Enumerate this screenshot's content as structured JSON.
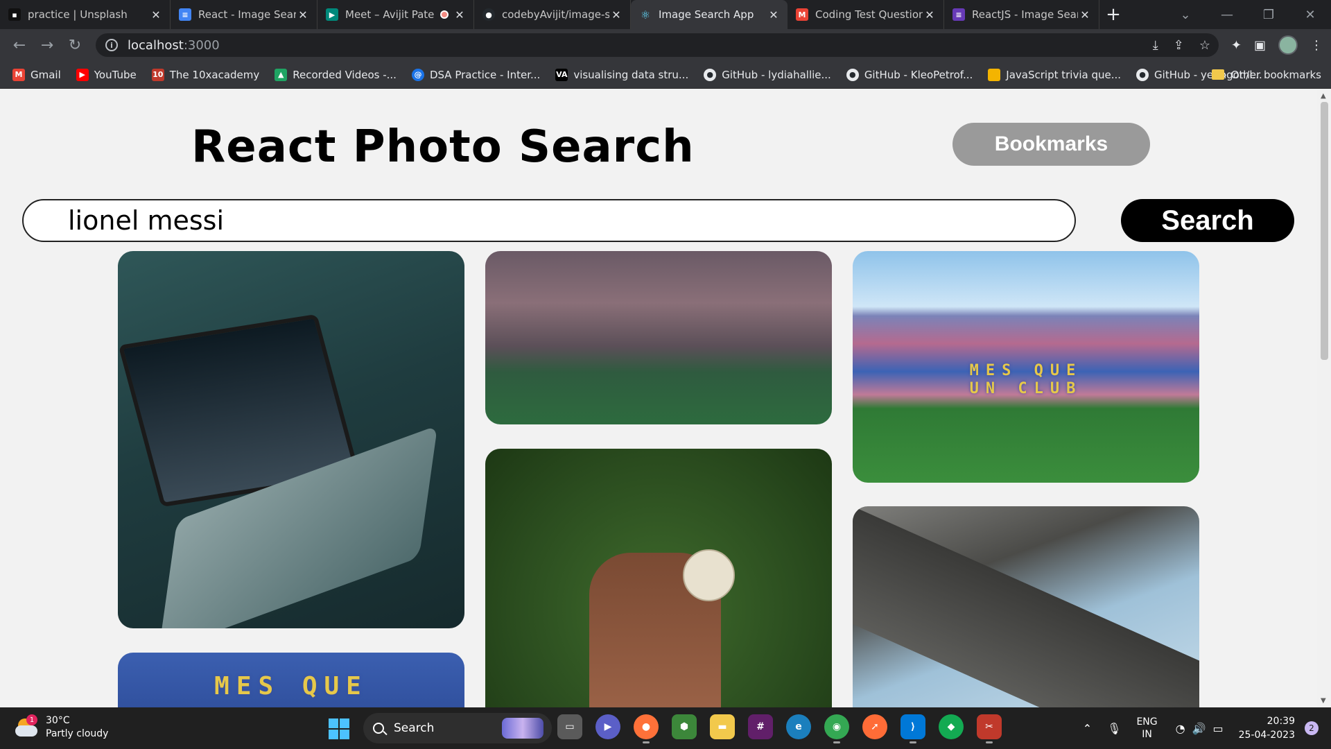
{
  "browser": {
    "tabs": [
      {
        "title": "practice | Unsplash",
        "icon": "unsplash-icon",
        "color": "#111111",
        "active": false
      },
      {
        "title": "React - Image Search",
        "icon": "docs-icon",
        "color": "#4285f4",
        "active": false
      },
      {
        "title": "Meet – Avijit Pate",
        "icon": "meet-icon",
        "color": "#00897b",
        "active": false,
        "recording": true
      },
      {
        "title": "codebyAvijit/image-se",
        "icon": "github-icon",
        "color": "#24292e",
        "active": false
      },
      {
        "title": "Image Search App",
        "icon": "react-icon",
        "color": "#35363a",
        "active": true
      },
      {
        "title": "Coding Test Question",
        "icon": "gmail-icon",
        "color": "#ea4335",
        "active": false
      },
      {
        "title": "ReactJS - Image Searc",
        "icon": "forms-icon",
        "color": "#673ab7",
        "active": false
      }
    ],
    "address": {
      "host": "localhost",
      "port": ":3000"
    },
    "bookmarks": [
      {
        "label": "Gmail",
        "icon": "gmail-icon",
        "color": "#ea4335"
      },
      {
        "label": "YouTube",
        "icon": "youtube-icon",
        "color": "#ff0000"
      },
      {
        "label": "The 10xacademy",
        "icon": "10x-icon",
        "color": "#c0392b"
      },
      {
        "label": "Recorded Videos -...",
        "icon": "drive-icon",
        "color": "#1fa463"
      },
      {
        "label": "DSA Practice - Inter...",
        "icon": "at-icon",
        "color": "#1a73e8"
      },
      {
        "label": "visualising data stru...",
        "icon": "visualgo-icon",
        "color": "#000000"
      },
      {
        "label": "GitHub - lydiahallie...",
        "icon": "github-icon",
        "color": "#24292e"
      },
      {
        "label": "GitHub - KleoPetrof...",
        "icon": "github-icon",
        "color": "#24292e"
      },
      {
        "label": "JavaScript trivia que...",
        "icon": "note-icon",
        "color": "#f4b400"
      },
      {
        "label": "GitHub - yeungon/l...",
        "icon": "github-icon",
        "color": "#24292e"
      }
    ],
    "bookmarks_more": "»",
    "other_bookmarks": "Other bookmarks"
  },
  "app": {
    "title": "React Photo Search",
    "bookmarks_button": "Bookmarks",
    "search_value": "lionel messi",
    "search_button": "Search",
    "photos": [
      {
        "name": "photo-laptop-messi",
        "subject": "laptop showing celebration"
      },
      {
        "name": "photo-stadium-crowd",
        "subject": "stadium crowd"
      },
      {
        "name": "photo-camp-nou",
        "subject": "stadium seats",
        "caption_line1": "MES QUE",
        "caption_line2": "UN CLUB"
      },
      {
        "name": "photo-football-player",
        "subject": "player lying with ball"
      },
      {
        "name": "photo-stadium-roof",
        "subject": "stadium roof and sky"
      },
      {
        "name": "photo-mes-que-seats",
        "subject": "stadium seats",
        "caption_line1": "MES QUE"
      }
    ]
  },
  "taskbar": {
    "weather_temp": "30°C",
    "weather_desc": "Partly cloudy",
    "weather_badge": "1",
    "search_label": "Search",
    "apps": [
      {
        "icon": "file-explorer-view-icon",
        "color": "#5a5a5a"
      },
      {
        "icon": "teams-chat-icon",
        "color": "#5b5fc7"
      },
      {
        "icon": "firefox-icon",
        "color": "#ff7139"
      },
      {
        "icon": "nodejs-icon",
        "color": "#3c873a"
      },
      {
        "icon": "folder-icon",
        "color": "#f2c94c"
      },
      {
        "icon": "slack-icon",
        "color": "#611f69"
      },
      {
        "icon": "edge-icon",
        "color": "#1b7fbd"
      },
      {
        "icon": "chrome-icon",
        "color": "#34a853"
      },
      {
        "icon": "postman-icon",
        "color": "#ff6c37"
      },
      {
        "icon": "vscode-icon",
        "color": "#0078d7"
      },
      {
        "icon": "mongodb-icon",
        "color": "#13aa52"
      },
      {
        "icon": "snipping-tool-icon",
        "color": "#c0392b"
      }
    ],
    "lang_line1": "ENG",
    "lang_line2": "IN",
    "time": "20:39",
    "date": "25-04-2023",
    "notifications": "2"
  }
}
